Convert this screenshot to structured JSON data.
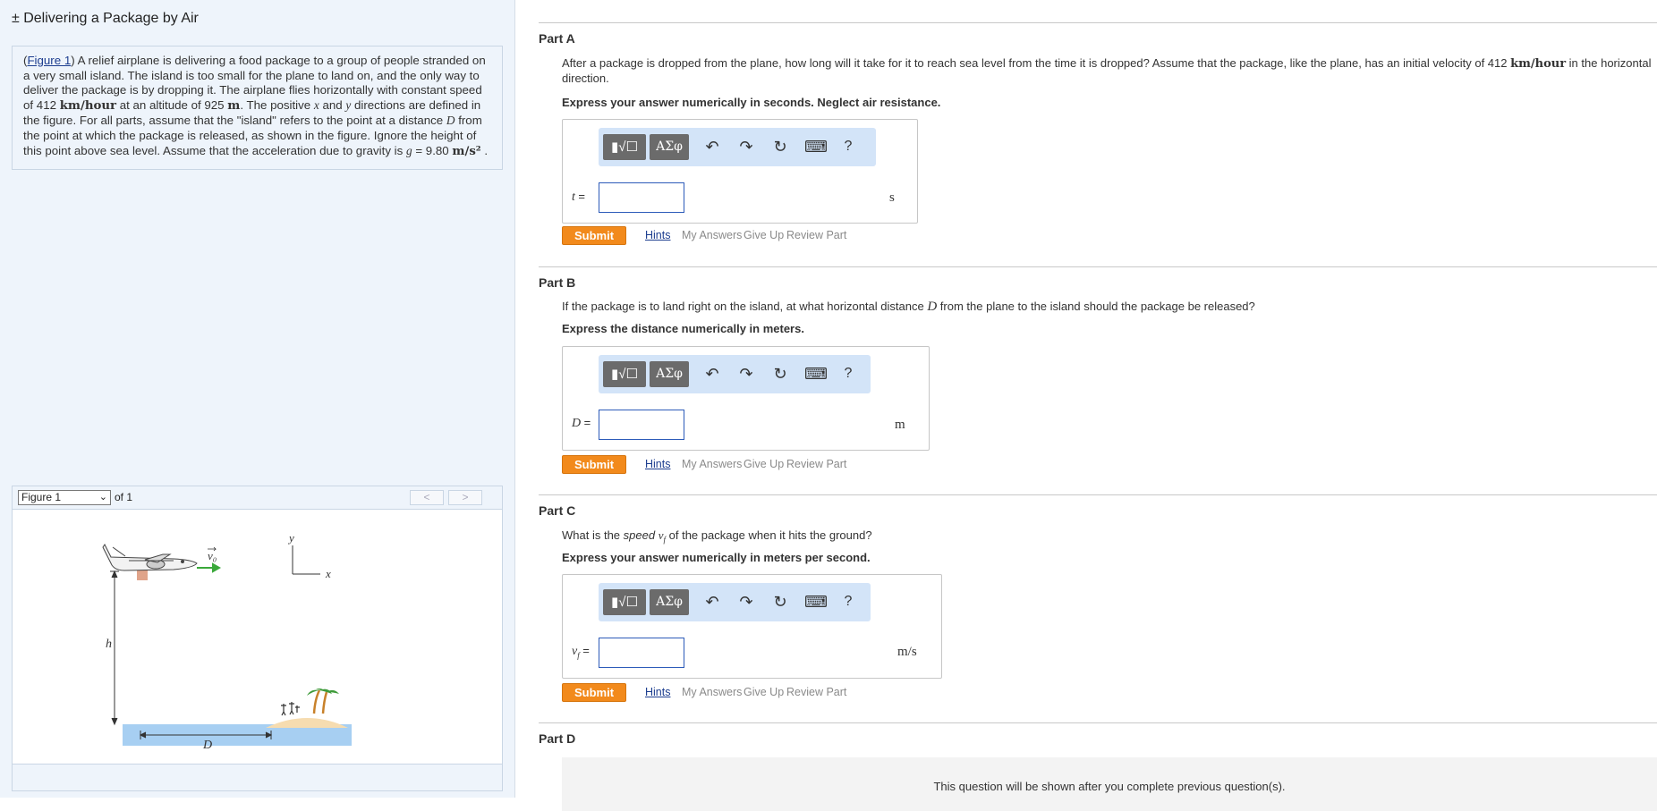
{
  "title": "± Delivering a Package by Air",
  "problem": {
    "link_text": "Figure 1",
    "p1": "A relief airplane is delivering a food package to a group of people stranded on a very small island. The island is too small for the plane to land on, and the only way to deliver the package is by dropping it. The airplane flies horizontally with constant speed of",
    "speed_value": "412",
    "speed_unit": "km/hour",
    "p2": "at an altitude of 925",
    "alt_unit": "m",
    "p3": ". The positive",
    "x": "x",
    "and": "and",
    "y": "y",
    "p4": "directions are defined in the figure. For all parts, assume that the \"island\" refers to the point at a distance",
    "D": "D",
    "p5": "from the point at which the package is released, as shown in the figure. Ignore the height of this point above sea level. Assume that the acceleration due to gravity is",
    "g": "g",
    "g_eq": "= 9.80",
    "g_unit": "m/s²",
    "p6": "."
  },
  "figure_nav": {
    "select_value": "Figure 1",
    "of_text": "of 1",
    "prev": "<",
    "next": ">"
  },
  "figure_labels": {
    "v0": "v₀",
    "y": "y",
    "x": "x",
    "h": "h",
    "D": "D"
  },
  "toolbar": {
    "templates_icon": "template-icon",
    "symbols_label": "ΑΣφ",
    "undo": "↶",
    "redo": "↷",
    "reset": "↻",
    "keyboard": "⌨",
    "help": "?"
  },
  "actions": {
    "submit": "Submit",
    "hints": "Hints",
    "my_answers": "My Answers",
    "give_up": "Give Up",
    "review_part": "Review Part"
  },
  "parts": {
    "A": {
      "label": "Part A",
      "q1": "After a package is dropped from the plane, how long will it take for it to reach sea level from the time it is dropped? Assume that the package, like the plane, has an initial velocity of 412",
      "q_unit": "km/hour",
      "q2": "in the horizontal direction.",
      "instruction": "Express your answer numerically in seconds. Neglect air resistance.",
      "var": "t",
      "eq": "=",
      "value": "",
      "unit": "s"
    },
    "B": {
      "label": "Part B",
      "q1": "If the package is to land right on the island, at what horizontal distance",
      "q_var": "D",
      "q2": "from the plane to the island should the package be released?",
      "instruction": "Express the distance numerically in meters.",
      "var": "D",
      "eq": "=",
      "value": "",
      "unit": "m"
    },
    "C": {
      "label": "Part C",
      "q1": "What is the",
      "q_em": "speed",
      "q_var": "v",
      "q_sub": "f",
      "q2": "of the package when it hits the ground?",
      "instruction": "Express your answer numerically in meters per second.",
      "var": "v",
      "var_sub": "f",
      "eq": "=",
      "value": "",
      "unit": "m/s"
    },
    "D": {
      "label": "Part D",
      "message": "This question will be shown after you complete previous question(s)."
    }
  }
}
